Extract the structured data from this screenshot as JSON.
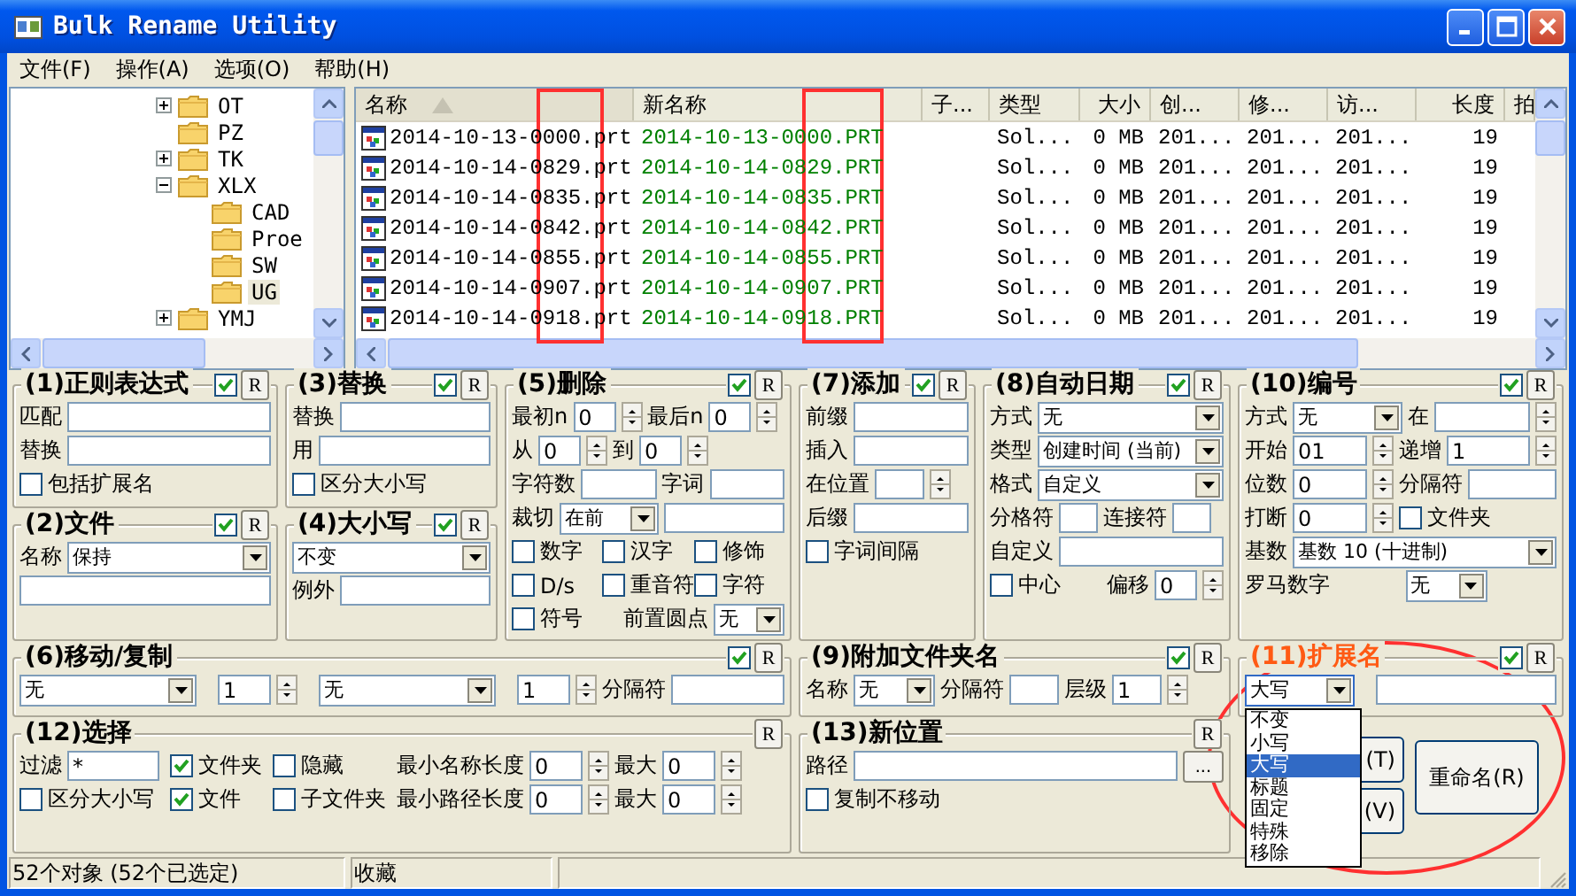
{
  "window": {
    "title": "Bulk Rename Utility"
  },
  "menu": [
    {
      "label": "文件(F)"
    },
    {
      "label": "操作(A)"
    },
    {
      "label": "选项(O)"
    },
    {
      "label": "帮助(H)"
    }
  ],
  "tree": [
    {
      "label": "OT",
      "expanded": false,
      "selected": false
    },
    {
      "label": "PZ",
      "selected": false
    },
    {
      "label": "TK",
      "expanded": false,
      "selected": false
    },
    {
      "label": "XLX",
      "expanded": true,
      "selected": false,
      "children": [
        {
          "label": "CAD",
          "selected": false
        },
        {
          "label": "Proe",
          "selected": false
        },
        {
          "label": "SW",
          "selected": false
        },
        {
          "label": "UG",
          "selected": true
        }
      ]
    },
    {
      "label": "YMJ",
      "expanded": false,
      "selected": false
    }
  ],
  "file_list": {
    "columns": [
      {
        "label": "名称",
        "sorted": true
      },
      {
        "label": "新名称",
        "sorted": false
      },
      {
        "label": "子...",
        "sorted": false
      },
      {
        "label": "类型",
        "sorted": false
      },
      {
        "label": "大小",
        "sorted": false
      },
      {
        "label": "创...",
        "sorted": false
      },
      {
        "label": "修...",
        "sorted": false
      },
      {
        "label": "访...",
        "sorted": false
      },
      {
        "label": "长度",
        "sorted": false
      },
      {
        "label": "拍",
        "sorted": false
      }
    ],
    "rows": [
      {
        "name": "2014-10-13-0000.prt",
        "new_name": "2014-10-13-0000.PRT",
        "type": "Sol...",
        "size": "0 MB",
        "created": "201...",
        "modified": "201...",
        "accessed": "201...",
        "length": "19"
      },
      {
        "name": "2014-10-14-0829.prt",
        "new_name": "2014-10-14-0829.PRT",
        "type": "Sol...",
        "size": "0 MB",
        "created": "201...",
        "modified": "201...",
        "accessed": "201...",
        "length": "19"
      },
      {
        "name": "2014-10-14-0835.prt",
        "new_name": "2014-10-14-0835.PRT",
        "type": "Sol...",
        "size": "0 MB",
        "created": "201...",
        "modified": "201...",
        "accessed": "201...",
        "length": "19"
      },
      {
        "name": "2014-10-14-0842.prt",
        "new_name": "2014-10-14-0842.PRT",
        "type": "Sol...",
        "size": "0 MB",
        "created": "201...",
        "modified": "201...",
        "accessed": "201...",
        "length": "19"
      },
      {
        "name": "2014-10-14-0855.prt",
        "new_name": "2014-10-14-0855.PRT",
        "type": "Sol...",
        "size": "0 MB",
        "created": "201...",
        "modified": "201...",
        "accessed": "201...",
        "length": "19"
      },
      {
        "name": "2014-10-14-0907.prt",
        "new_name": "2014-10-14-0907.PRT",
        "type": "Sol...",
        "size": "0 MB",
        "created": "201...",
        "modified": "201...",
        "accessed": "201...",
        "length": "19"
      },
      {
        "name": "2014-10-14-0918.prt",
        "new_name": "2014-10-14-0918.PRT",
        "type": "Sol...",
        "size": "0 MB",
        "created": "201...",
        "modified": "201...",
        "accessed": "201...",
        "length": "19"
      }
    ]
  },
  "regex": {
    "title": "(1)正则表达式",
    "enabled": true,
    "reset": "R",
    "fields": [
      {
        "label": "匹配"
      },
      {
        "label": "替换"
      }
    ],
    "options": [
      {
        "label": "包括扩展名",
        "checked": false
      }
    ]
  },
  "file": {
    "title": "(2)文件",
    "enabled": true,
    "reset": "R",
    "name": {
      "label": "名称",
      "value": "保持"
    }
  },
  "replace": {
    "title": "(3)替换",
    "enabled": true,
    "reset": "R",
    "fields": [
      {
        "label": "替换"
      },
      {
        "label": "用"
      }
    ],
    "options": [
      {
        "label": "区分大小写",
        "checked": false
      }
    ]
  },
  "case": {
    "title": "(4)大小写",
    "enabled": true,
    "reset": "R",
    "mode": {
      "value": "不变"
    },
    "except": {
      "label": "例外"
    }
  },
  "remove": {
    "title": "(5)删除",
    "enabled": true,
    "reset": "R",
    "spins": [
      {
        "label": "最初n",
        "value": "0"
      },
      {
        "label": "最后n",
        "value": "0"
      },
      {
        "label": "从",
        "value": "0"
      },
      {
        "label": "到",
        "value": "0"
      }
    ],
    "fields": [
      {
        "label": "字符数"
      },
      {
        "label": "字词"
      }
    ],
    "crop": {
      "label": "裁切",
      "value": "在前"
    },
    "options": [
      {
        "label": "数字",
        "checked": false
      },
      {
        "label": "汉字",
        "checked": false
      },
      {
        "label": "修饰",
        "checked": false
      },
      {
        "label": "D/s",
        "checked": false
      },
      {
        "label": "重音符",
        "checked": false
      },
      {
        "label": "字符",
        "checked": false
      },
      {
        "label": "符号",
        "checked": false
      }
    ],
    "lead_dots": {
      "label": "前置圆点",
      "value": "无"
    }
  },
  "move": {
    "title": "(6)移动/复制",
    "enabled": true,
    "reset": "R",
    "from": {
      "value": "无"
    },
    "from_count": {
      "value": "1"
    },
    "to": {
      "value": "无"
    },
    "to_count": {
      "value": "1"
    },
    "separator": {
      "label": "分隔符"
    }
  },
  "add": {
    "title": "(7)添加",
    "enabled": true,
    "reset": "R",
    "fields": [
      {
        "label": "前缀"
      },
      {
        "label": "插入"
      }
    ],
    "position": {
      "label": "在位置"
    },
    "suffix": {
      "label": "后缀"
    },
    "options": [
      {
        "label": "字词间隔",
        "checked": false
      }
    ]
  },
  "auto_date": {
    "title": "(8)自动日期",
    "enabled": true,
    "reset": "R",
    "combos": [
      {
        "label": "方式",
        "value": "无"
      },
      {
        "label": "类型",
        "value": "创建时间 (当前)"
      },
      {
        "label": "格式",
        "value": "自定义"
      }
    ],
    "separators": [
      {
        "label": "分格符"
      },
      {
        "label": "连接符"
      }
    ],
    "custom": {
      "label": "自定义"
    },
    "center": {
      "label": "中心",
      "checked": false
    },
    "offset": {
      "label": "偏移",
      "value": "0"
    }
  },
  "append_folder": {
    "title": "(9)附加文件夹名",
    "enabled": true,
    "reset": "R",
    "name": {
      "label": "名称",
      "value": "无"
    },
    "separator": {
      "label": "分隔符"
    },
    "level": {
      "label": "层级",
      "value": "1"
    }
  },
  "numbering": {
    "title": "(10)编号",
    "enabled": true,
    "reset": "R",
    "mode": {
      "label": "方式",
      "value": "无"
    },
    "at": {
      "label": "在"
    },
    "start": {
      "label": "开始",
      "value": "01"
    },
    "step": {
      "label": "递增",
      "value": "1"
    },
    "pad": {
      "label": "位数",
      "value": "0"
    },
    "separator": {
      "label": "分隔符"
    },
    "break": {
      "label": "打断",
      "value": "0"
    },
    "folder": {
      "label": "文件夹",
      "checked": false
    },
    "base": {
      "label": "基数",
      "value": "基数 10 (十进制)"
    },
    "roman": {
      "label": "罗马数字",
      "value": "无"
    }
  },
  "extension": {
    "title": "(11)扩展名",
    "modified": true,
    "enabled": true,
    "reset": "R",
    "mode": {
      "value": "大写",
      "expanded": true
    },
    "options": [
      {
        "label": "不变",
        "selected": false
      },
      {
        "label": "小写",
        "selected": false
      },
      {
        "label": "大写",
        "selected": true
      },
      {
        "label": "标题",
        "selected": false
      },
      {
        "label": "固定",
        "selected": false
      },
      {
        "label": "特殊",
        "selected": false
      },
      {
        "label": "移除",
        "selected": false
      }
    ]
  },
  "selection": {
    "title": "(12)选择",
    "reset": "R",
    "filter": {
      "label": "过滤",
      "value": "*"
    },
    "options": [
      {
        "label": "文件夹",
        "checked": true
      },
      {
        "label": "隐藏",
        "checked": false
      },
      {
        "label": "区分大小写",
        "checked": false
      },
      {
        "label": "文件",
        "checked": true
      },
      {
        "label": "子文件夹",
        "checked": false
      }
    ],
    "lengths": [
      {
        "label": "最小名称长度",
        "value": "0"
      },
      {
        "label": "最大",
        "value": "0"
      },
      {
        "label": "最小路径长度",
        "value": "0"
      },
      {
        "label": "最大",
        "value": "0"
      }
    ]
  },
  "new_location": {
    "title": "(13)新位置",
    "reset": "R",
    "path": {
      "label": "路径"
    },
    "browse": "...",
    "options": [
      {
        "label": "复制不移动",
        "checked": false
      }
    ]
  },
  "buttons": [
    {
      "label": "(T)"
    },
    {
      "label": "(V)"
    },
    {
      "label": "重命名(R)"
    }
  ],
  "status_bar": [
    "52个对象 (52个已选定)",
    "收藏"
  ]
}
